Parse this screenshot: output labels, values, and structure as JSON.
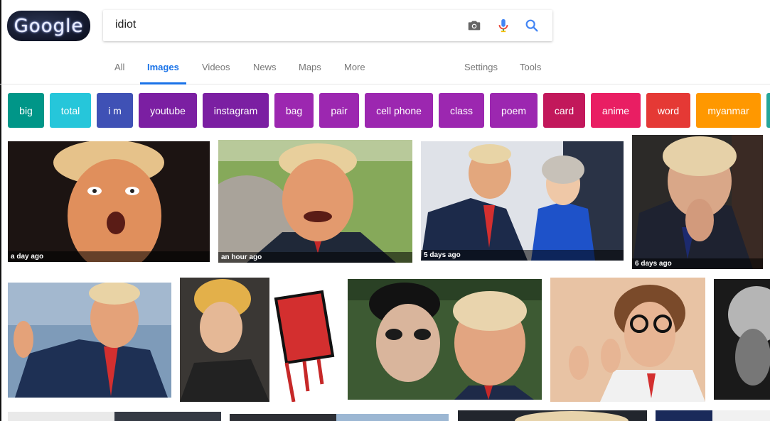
{
  "logo": {
    "text": "Google"
  },
  "search": {
    "query": "idiot"
  },
  "icons": {
    "camera": "camera-icon",
    "mic": "mic-icon",
    "search": "search-icon"
  },
  "tabs": [
    {
      "label": "All"
    },
    {
      "label": "Images",
      "active": true
    },
    {
      "label": "Videos"
    },
    {
      "label": "News"
    },
    {
      "label": "Maps"
    },
    {
      "label": "More"
    },
    {
      "label": "Settings"
    },
    {
      "label": "Tools"
    }
  ],
  "chips": [
    {
      "label": "big",
      "color": "#009688"
    },
    {
      "label": "total",
      "color": "#26c6da"
    },
    {
      "label": "i m",
      "color": "#3f51b5"
    },
    {
      "label": "youtube",
      "color": "#7b1fa2"
    },
    {
      "label": "instagram",
      "color": "#7b1fa2"
    },
    {
      "label": "bag",
      "color": "#9c27b0"
    },
    {
      "label": "pair",
      "color": "#9c27b0"
    },
    {
      "label": "cell phone",
      "color": "#9c27b0"
    },
    {
      "label": "class",
      "color": "#9c27b0"
    },
    {
      "label": "poem",
      "color": "#9c27b0"
    },
    {
      "label": "card",
      "color": "#c2185b"
    },
    {
      "label": "anime",
      "color": "#e91e63"
    },
    {
      "label": "word",
      "color": "#e53935"
    },
    {
      "label": "myanmar",
      "color": "#ff9800"
    },
    {
      "label": "",
      "color": "#26a69a"
    }
  ],
  "results": [
    {
      "age": "a day ago"
    },
    {
      "age": "an hour ago"
    },
    {
      "age": "5 days ago"
    },
    {
      "age": "6 days ago"
    }
  ]
}
